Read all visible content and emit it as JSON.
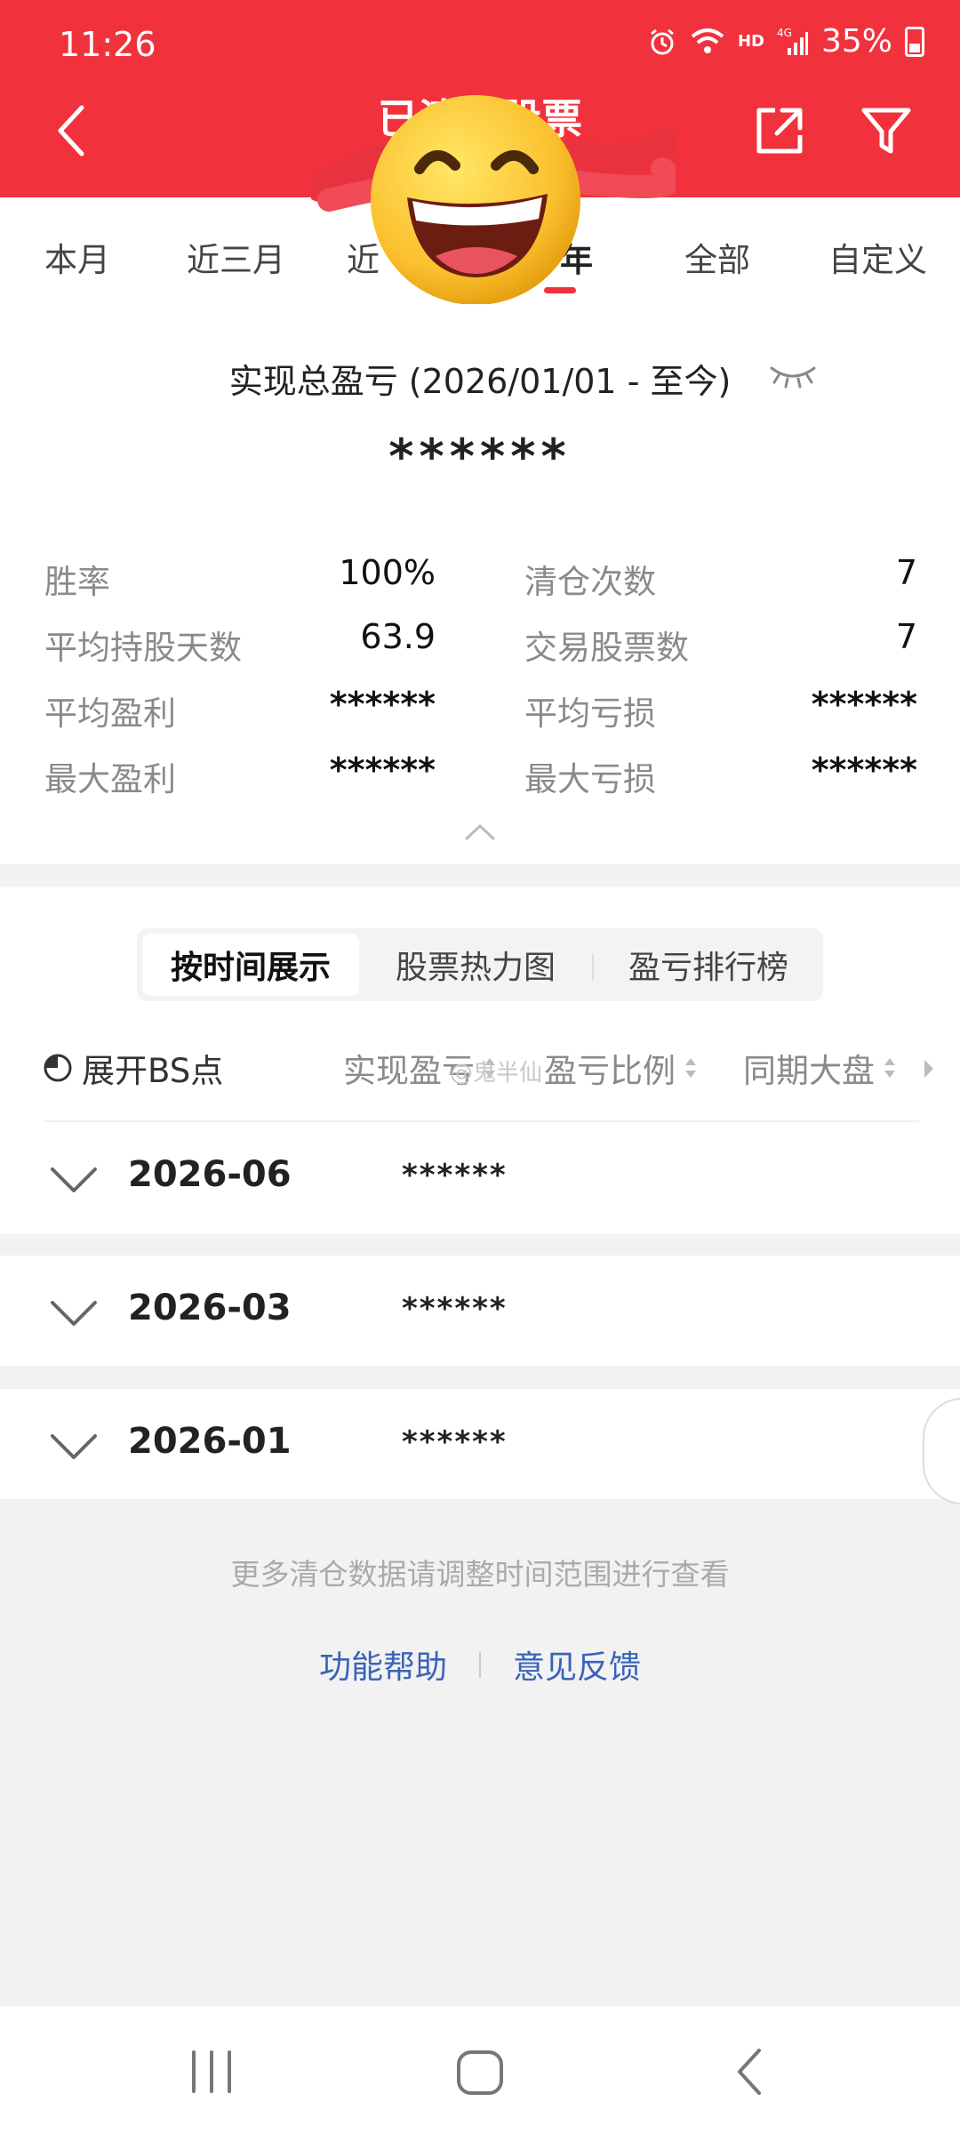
{
  "status_bar": {
    "time": "11:26",
    "network": "HD",
    "signal": "4G",
    "battery": "35%",
    "icons": [
      "alarm-icon",
      "wifi-icon",
      "signal-icon",
      "battery-icon"
    ]
  },
  "header": {
    "title": "已清仓股票",
    "back_icon": "back-arrow-icon",
    "share_icon": "share-icon",
    "filter_icon": "filter-icon"
  },
  "period_tabs": {
    "items": [
      "本月",
      "近三月",
      "近半年",
      "今年",
      "全部",
      "自定义"
    ],
    "visible_labels": [
      "本月",
      "近三月",
      "近",
      "年",
      "全部",
      "自定义"
    ],
    "active_index": 3
  },
  "summary": {
    "title": "实现总盈亏 (2026/01/01 - 至今)",
    "value": "******",
    "eye_icon": "eye-closed-icon",
    "stats": {
      "win_rate_label": "胜率",
      "win_rate_value": "100%",
      "clear_count_label": "清仓次数",
      "clear_count_value": "7",
      "avg_days_label": "平均持股天数",
      "avg_days_value": "63.9",
      "traded_stocks_label": "交易股票数",
      "traded_stocks_value": "7",
      "avg_profit_label": "平均盈利",
      "avg_profit_value": "******",
      "avg_loss_label": "平均亏损",
      "avg_loss_value": "******",
      "max_profit_label": "最大盈利",
      "max_profit_value": "******",
      "max_loss_label": "最大亏损",
      "max_loss_value": "******"
    }
  },
  "view_tabs": {
    "items": [
      "按时间展示",
      "股票热力图",
      "盈亏排行榜"
    ],
    "active_index": 0
  },
  "columns": {
    "bs_toggle": "展开BS点",
    "realized_pnl": "实现盈亏",
    "pnl_ratio": "盈亏比例",
    "benchmark": "同期大盘"
  },
  "watermark": "@鬼半仙",
  "months": [
    {
      "label": "2026-06",
      "value": "******"
    },
    {
      "label": "2026-03",
      "value": "******"
    },
    {
      "label": "2026-01",
      "value": "******"
    }
  ],
  "footer": {
    "tip": "更多清仓数据请调整时间范围进行查看",
    "help": "功能帮助",
    "feedback": "意见反馈"
  },
  "colors": {
    "brand_red": "#f1323d",
    "link_blue": "#3a62b8"
  }
}
